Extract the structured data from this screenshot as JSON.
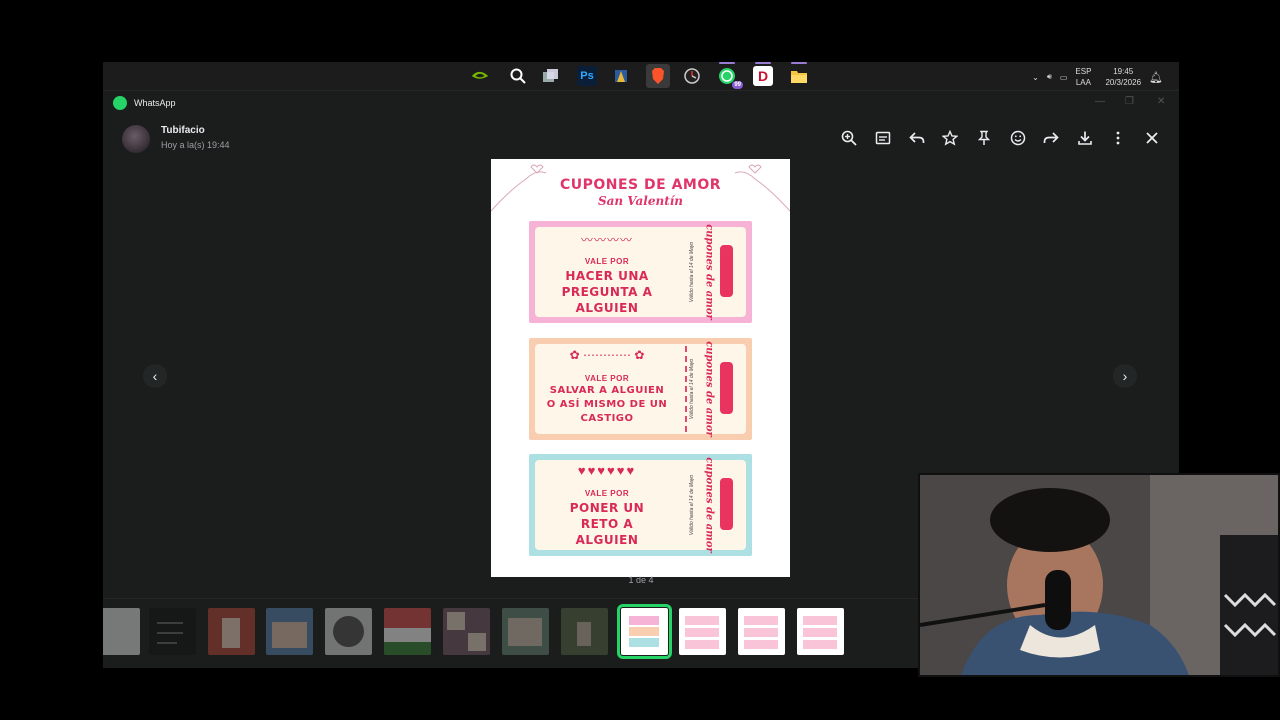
{
  "taskbar": {
    "icons": [
      "nvidia-icon",
      "search-icon",
      "task-view-icon",
      "photoshop-icon",
      "app-icon",
      "brave-icon",
      "clock-app-icon",
      "whatsapp-icon",
      "d-app-icon",
      "file-explorer-icon"
    ],
    "photoshop_label": "Ps",
    "d_label": "D",
    "whatsapp_badge": "99",
    "language_top": "ESP",
    "language_bottom": "LAA",
    "time": "19:45",
    "date": "20/3/2026"
  },
  "window": {
    "title": "WhatsApp"
  },
  "header": {
    "sender": "Tubifacio",
    "sent_time": "Hoy a la(s) 19:44",
    "actions": [
      "zoom-in-icon",
      "caption-icon",
      "reply-icon",
      "star-icon",
      "pin-icon",
      "react-icon",
      "forward-icon",
      "download-icon",
      "more-icon",
      "close-icon"
    ]
  },
  "image": {
    "title": "CUPONES DE AMOR",
    "subtitle": "San Valentín",
    "coupons": [
      {
        "vale": "VALE POR",
        "lines": [
          "HACER UNA",
          "PREGUNTA A",
          "ALGUIEN"
        ],
        "brand": "cupones de amor",
        "valid": "Válido hasta el 14 de Mayo",
        "color": "#f6b3d5"
      },
      {
        "vale": "VALE POR",
        "lines": [
          "SALVAR A ALGUIEN",
          "O ASÍ MISMO DE UN",
          "CASTIGO"
        ],
        "brand": "cupones de amor",
        "valid": "Válido hasta el 14 de Mayo",
        "color": "#f9cdb0"
      },
      {
        "vale": "VALE POR",
        "lines": [
          "PONER UN",
          "RETO A",
          "ALGUIEN"
        ],
        "brand": "cupones de amor",
        "valid": "Válido hasta el 14 de Mayo",
        "color": "#ade0e3"
      }
    ]
  },
  "pagination": {
    "label": "1 de 4"
  },
  "colors": {
    "accent": "#25d366",
    "coupon_text": "#d82a55",
    "background": "#1b1c1c"
  }
}
